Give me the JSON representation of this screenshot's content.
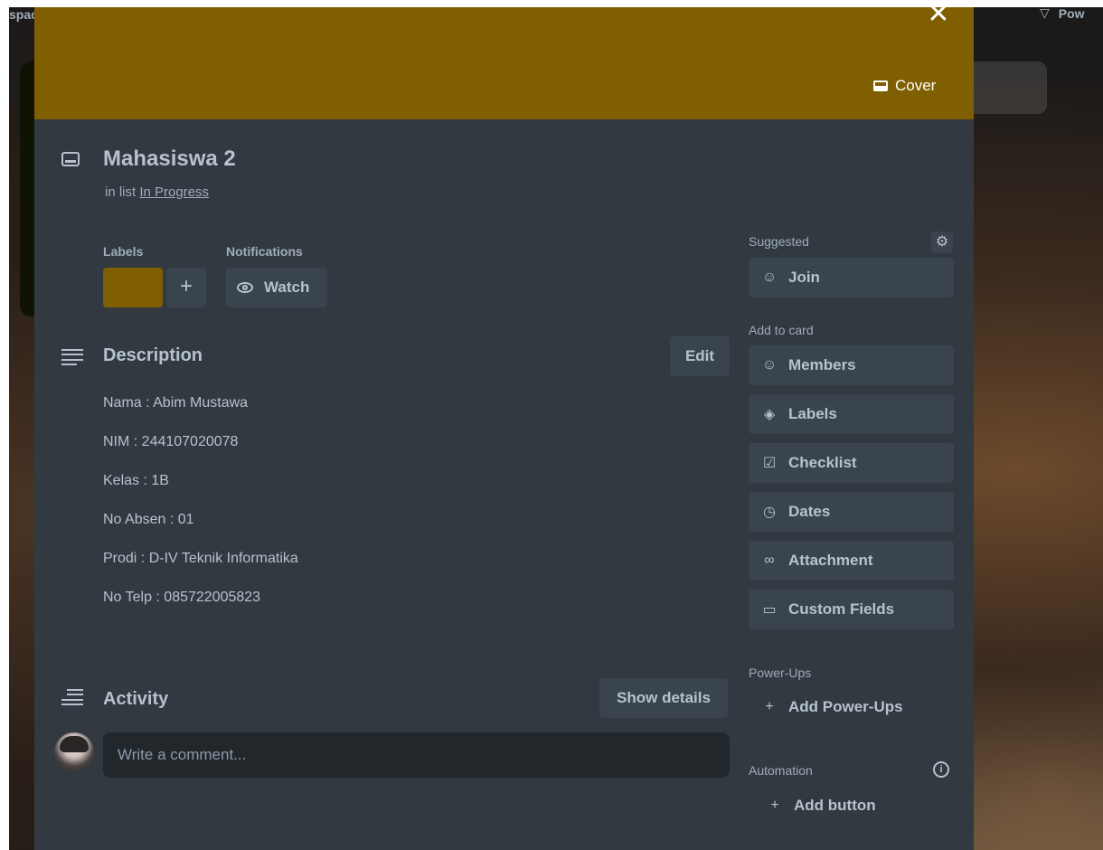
{
  "background": {
    "top_left_text": "spac",
    "top_right_text": "Pow"
  },
  "card": {
    "cover_button": "Cover",
    "title": "Mahasiswa 2",
    "in_list_prefix": "in list",
    "list_name": "In Progress",
    "labels_heading": "Labels",
    "notifications_heading": "Notifications",
    "label_color": "#7f5f01",
    "add_label": "+",
    "watch_label": "Watch"
  },
  "description": {
    "heading": "Description",
    "edit_label": "Edit",
    "lines": [
      "Nama : Abim Mustawa",
      "NIM : 244107020078",
      "Kelas : 1B",
      "No Absen : 01",
      "Prodi : D-IV Teknik Informatika",
      "No Telp : 085722005823"
    ]
  },
  "activity": {
    "heading": "Activity",
    "show_details": "Show details",
    "comment_placeholder": "Write a comment..."
  },
  "sidebar": {
    "suggested": "Suggested",
    "join": "Join",
    "add_to_card": "Add to card",
    "items": [
      "Members",
      "Labels",
      "Checklist",
      "Dates",
      "Attachment",
      "Custom Fields"
    ],
    "power_ups": "Power-Ups",
    "add_power_ups": "Add Power-Ups",
    "automation": "Automation",
    "add_button": "Add button"
  }
}
